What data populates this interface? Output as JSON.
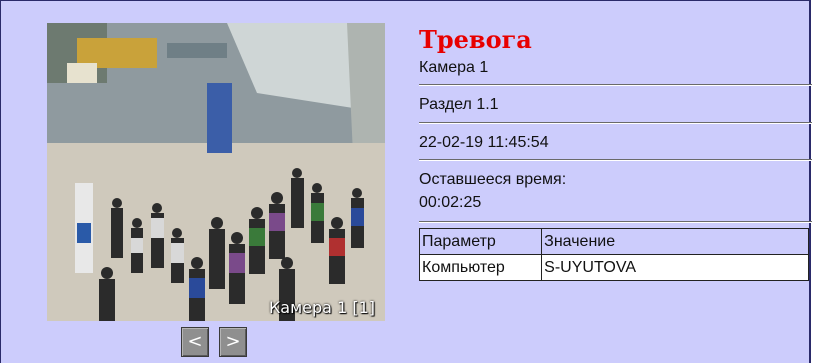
{
  "camera_view": {
    "label": "Камера 1 [1]"
  },
  "navigation": {
    "prev_label": "<",
    "next_label": ">"
  },
  "alarm": {
    "title": "Тревога",
    "camera": "Камера 1",
    "section": "Раздел 1.1",
    "datetime": "22-02-19 11:45:54",
    "remaining_label": "Оставшееся время:",
    "remaining_value": "00:02:25"
  },
  "params_table": {
    "headers": [
      "Параметр",
      "Значение"
    ],
    "rows": [
      [
        "Компьютер",
        "S-UYUTOVA"
      ]
    ]
  },
  "colors": {
    "panel_background": "#ccccfc",
    "alarm_title": "#e80000",
    "nav_button": "#8f8f8f"
  }
}
